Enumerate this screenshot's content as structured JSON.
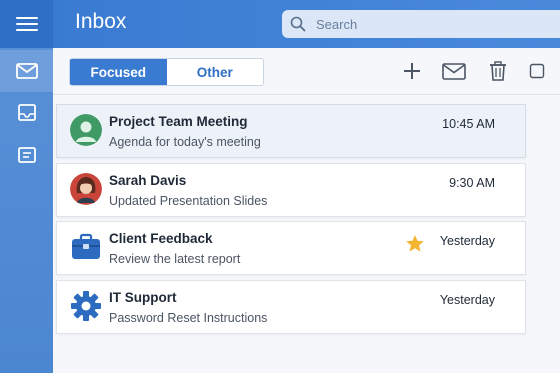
{
  "app": {
    "title": "Inbox"
  },
  "search": {
    "placeholder": "Search",
    "value": ""
  },
  "tabs": [
    {
      "label": "Focused",
      "active": true
    },
    {
      "label": "Other",
      "active": false
    }
  ],
  "toolbar": {
    "icons": [
      "add-icon",
      "mail-icon",
      "trash-icon",
      "square-icon"
    ]
  },
  "rail": {
    "icons": [
      "menu-icon",
      "mail-icon",
      "inbox-tray-icon",
      "notes-icon"
    ]
  },
  "messages": [
    {
      "sender": "Project Team Meeting",
      "subject": "Agenda for today's meeting",
      "time": "10:45 AM",
      "avatar": "person-avatar-green",
      "starred": false,
      "selected": true
    },
    {
      "sender": "Sarah Davis",
      "subject": "Updated Presentation Slides",
      "time": "9:30 AM",
      "avatar": "person-avatar-woman",
      "starred": false,
      "selected": false
    },
    {
      "sender": "Client Feedback",
      "subject": "Review the latest report",
      "time": "Yesterday",
      "avatar": "briefcase-icon",
      "starred": true,
      "selected": false
    },
    {
      "sender": "IT Support",
      "subject": "Password Reset Instructions",
      "time": "Yesterday",
      "avatar": "gear-icon",
      "starred": false,
      "selected": false
    }
  ],
  "colors": {
    "accent": "#3a7bd2",
    "rail": "#4b86d0",
    "star": "#f2b632"
  }
}
